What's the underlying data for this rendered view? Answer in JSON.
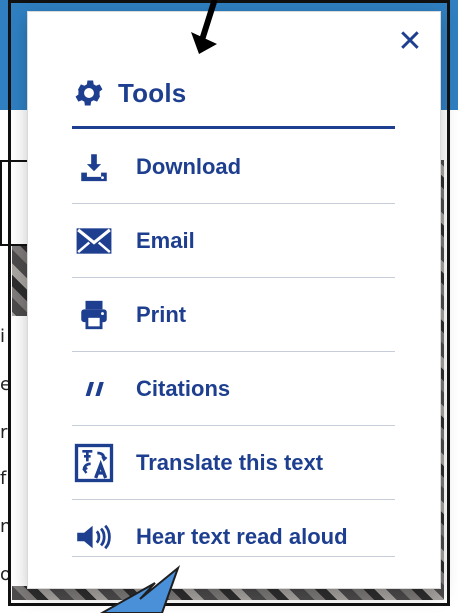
{
  "modal": {
    "title": "Tools",
    "items": [
      {
        "label": "Download",
        "icon": "download-icon"
      },
      {
        "label": "Email",
        "icon": "envelope-icon"
      },
      {
        "label": "Print",
        "icon": "printer-icon"
      },
      {
        "label": "Citations",
        "icon": "quote-icon"
      },
      {
        "label": "Translate this text",
        "icon": "translate-icon"
      },
      {
        "label": "Hear text read aloud",
        "icon": "speaker-icon"
      }
    ]
  },
  "background": {
    "left_text_fragments": [
      "i",
      "e",
      "r",
      "f",
      "n",
      "o"
    ]
  },
  "colors": {
    "brand_blue": "#1e3f8f",
    "top_bar_blue": "#2f7fc1",
    "pointer_blue": "#4a90d9"
  }
}
